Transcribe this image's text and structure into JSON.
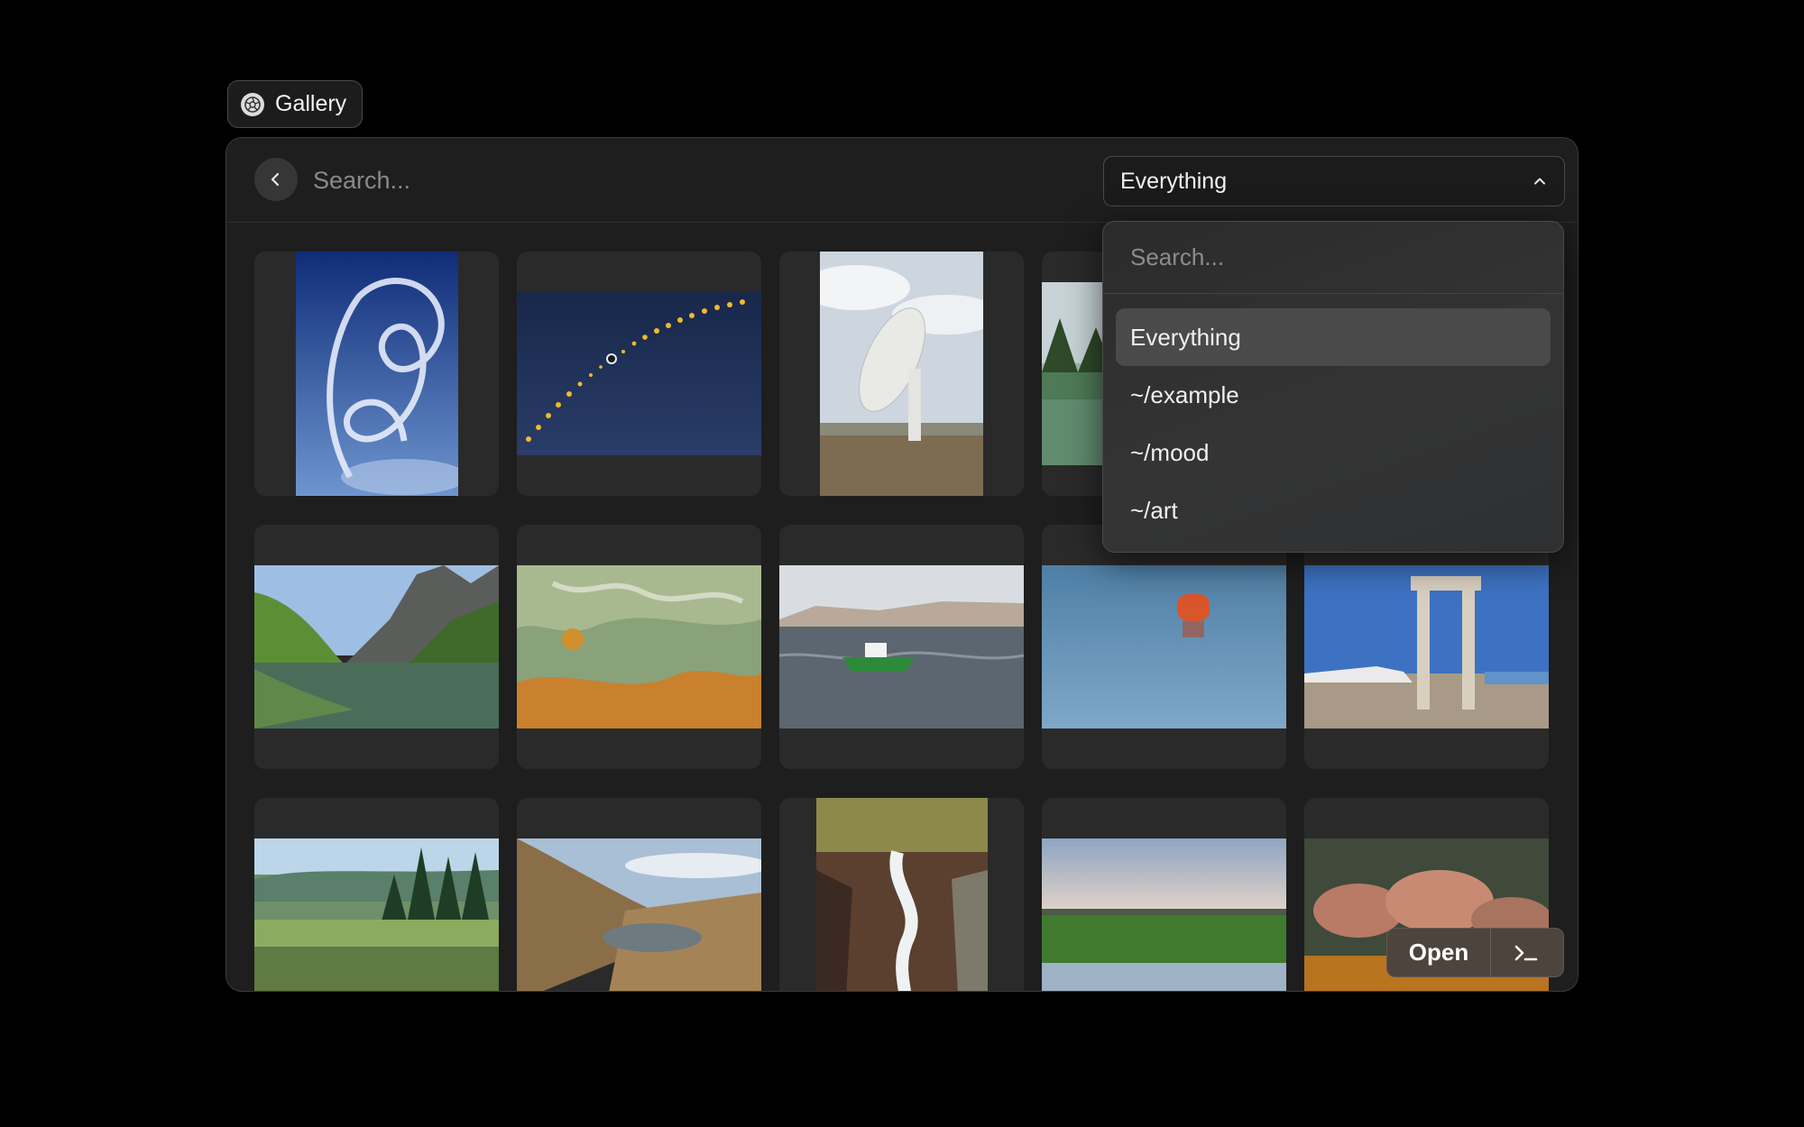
{
  "app": {
    "title": "Gallery",
    "icon": "aperture-icon"
  },
  "toolbar": {
    "back_icon": "chevron-left-icon",
    "search_placeholder": "Search...",
    "scope_value": "Everything",
    "scope_icon": "chevron-up-icon"
  },
  "dropdown": {
    "search_placeholder": "Search...",
    "items": [
      {
        "label": "Everything",
        "selected": true
      },
      {
        "label": "~/example",
        "selected": false
      },
      {
        "label": "~/mood",
        "selected": false
      },
      {
        "label": "~/art",
        "selected": false
      }
    ]
  },
  "actions": {
    "open_label": "Open",
    "terminal_icon": "terminal-icon"
  },
  "colors": {
    "background": "#000000",
    "window": "#1e1e1e",
    "tile": "#2a2a2a",
    "action_bar": "#4d443e"
  },
  "gallery": {
    "tiles": [
      {
        "name": "skywriting-loops-photo"
      },
      {
        "name": "solar-eclipse-sequence-photo"
      },
      {
        "name": "radio-telescope-dish-photo"
      },
      {
        "name": "forest-lake-reflection-photo"
      },
      {
        "name": "hidden-tile-photo"
      },
      {
        "name": "mountain-lake-valley-photo"
      },
      {
        "name": "green-rock-texture-photo"
      },
      {
        "name": "fishing-boat-sea-photo"
      },
      {
        "name": "red-buoy-water-photo"
      },
      {
        "name": "stone-portal-island-photo"
      },
      {
        "name": "pine-forest-lake-photo"
      },
      {
        "name": "alpine-pond-hills-photo"
      },
      {
        "name": "waterfall-rocks-photo"
      },
      {
        "name": "marsh-field-dusk-photo"
      },
      {
        "name": "orange-boulders-shore-photo"
      }
    ]
  }
}
